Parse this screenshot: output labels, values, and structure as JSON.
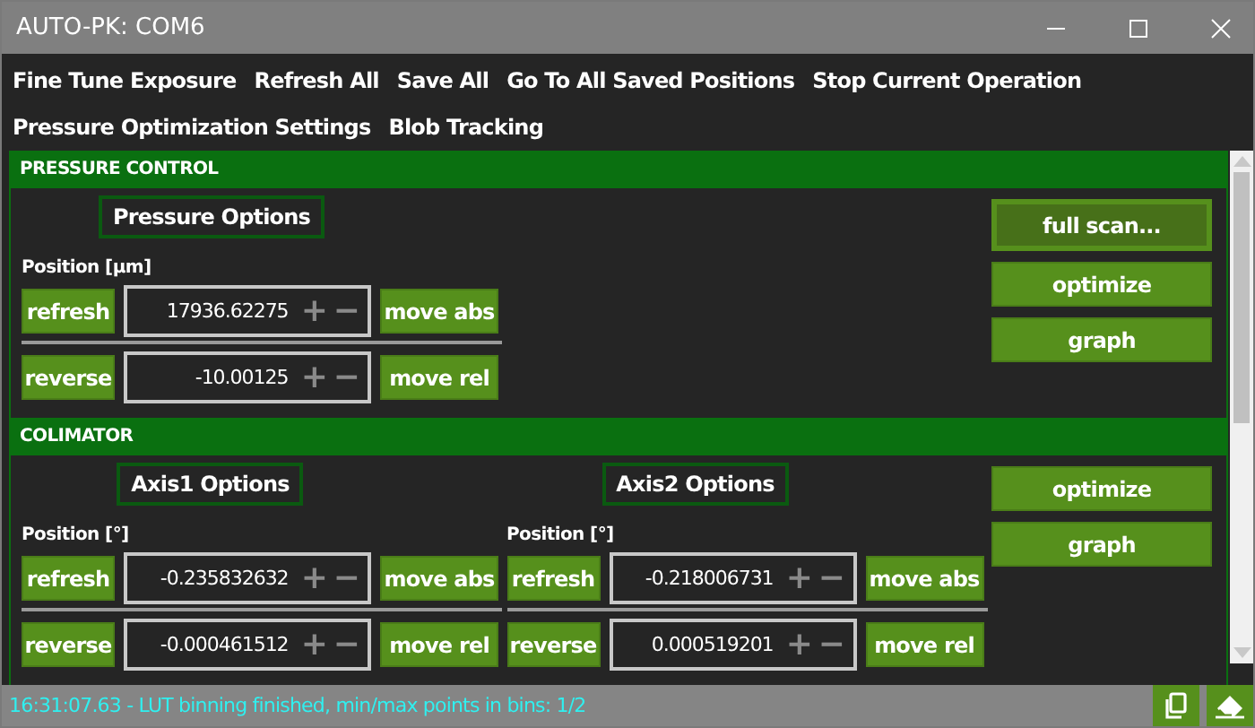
{
  "window": {
    "title": "AUTO-PK: COM6"
  },
  "menu": [
    [
      "Fine Tune Exposure",
      "Refresh All",
      "Save All",
      "Go To All Saved Positions",
      "Stop Current Operation"
    ],
    [
      "Pressure Optimization Settings",
      "Blob Tracking"
    ]
  ],
  "sections": [
    {
      "title": "PRESSURE CONTROL",
      "axes": [
        {
          "options": "Pressure Options",
          "position_label": "Position [µm]",
          "rows": [
            {
              "action": "refresh",
              "value": "17936.62275",
              "plus": "+",
              "minus": "−",
              "move": "move abs"
            },
            {
              "action": "reverse",
              "value": "-10.00125",
              "plus": "+",
              "minus": "−",
              "move": "move rel"
            }
          ]
        }
      ],
      "side_buttons": [
        {
          "label": "full scan...",
          "focused": true
        },
        {
          "label": "optimize",
          "focused": false
        },
        {
          "label": "graph",
          "focused": false
        }
      ]
    },
    {
      "title": "COLIMATOR",
      "axes": [
        {
          "options": "Axis1 Options",
          "position_label": "Position [°]",
          "rows": [
            {
              "action": "refresh",
              "value": "-0.235832632",
              "plus": "+",
              "minus": "−",
              "move": "move abs"
            },
            {
              "action": "reverse",
              "value": "-0.000461512",
              "plus": "+",
              "minus": "−",
              "move": "move rel"
            }
          ]
        },
        {
          "options": "Axis2 Options",
          "position_label": "Position [°]",
          "rows": [
            {
              "action": "refresh",
              "value": "-0.218006731",
              "plus": "+",
              "minus": "−",
              "move": "move abs"
            },
            {
              "action": "reverse",
              "value": "0.000519201",
              "plus": "+",
              "minus": "−",
              "move": "move rel"
            }
          ]
        }
      ],
      "side_buttons": [
        {
          "label": "optimize",
          "focused": false
        },
        {
          "label": "graph",
          "focused": false
        }
      ]
    }
  ],
  "status": {
    "message": "16:31:07.63 - LUT binning finished, min/max points in bins: 1/2"
  }
}
